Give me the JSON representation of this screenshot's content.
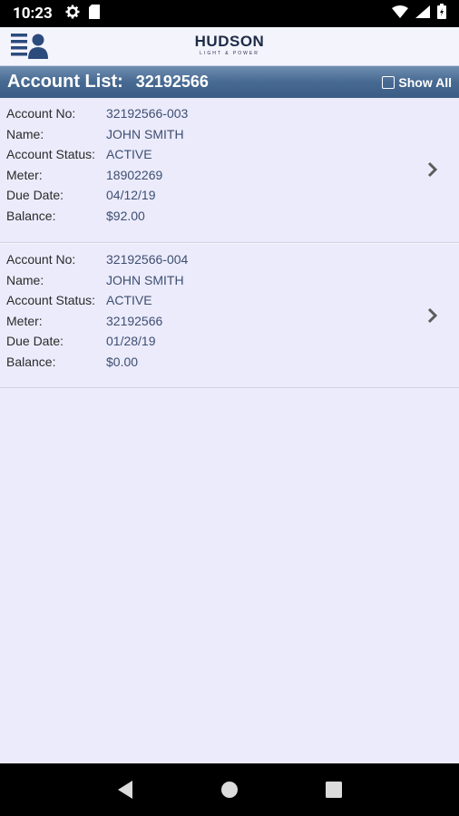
{
  "status_bar": {
    "time": "10:23",
    "icons": [
      "gear-icon",
      "sim-card-icon",
      "wifi-icon",
      "signal-icon",
      "battery-icon"
    ]
  },
  "header": {
    "menu_icon": "account-menu-icon",
    "logo_main": "HUDSON",
    "logo_sub": "LIGHT & POWER"
  },
  "title_bar": {
    "label": "Account List:",
    "account_number": "32192566",
    "show_all_label": "Show All"
  },
  "field_labels": {
    "account_no": "Account No:",
    "name": "Name:",
    "status": "Account Status:",
    "meter": "Meter:",
    "due_date": "Due Date:",
    "balance": "Balance:"
  },
  "accounts": [
    {
      "account_no": "32192566-003",
      "name": "JOHN SMITH",
      "status": "ACTIVE",
      "meter": "18902269",
      "due_date": "04/12/19",
      "balance": "$92.00"
    },
    {
      "account_no": "32192566-004",
      "name": "JOHN SMITH",
      "status": "ACTIVE",
      "meter": "32192566",
      "due_date": "01/28/19",
      "balance": "$0.00"
    }
  ],
  "colors": {
    "title_bar": "#476a92",
    "background": "#ecebfc",
    "value_text": "#3d4f70",
    "logo": "#1d2c47",
    "logo_accent": "#e8b51c"
  },
  "nav_bar": {
    "icons": [
      "back-icon",
      "home-icon",
      "recents-icon"
    ]
  }
}
